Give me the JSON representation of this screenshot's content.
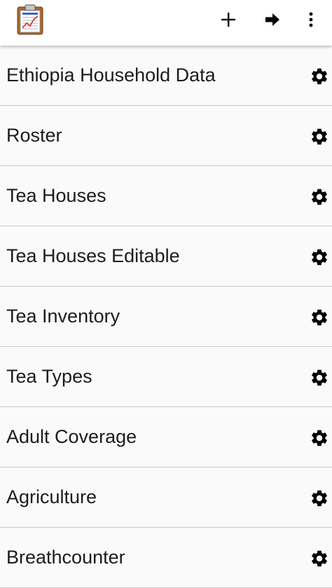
{
  "toolbar": {
    "app_icon": "clipboard-chart-icon",
    "add_icon": "plus-icon",
    "next_icon": "arrow-right-icon",
    "more_icon": "more-vert-icon"
  },
  "list": {
    "items": [
      {
        "label": "Ethiopia Household Data"
      },
      {
        "label": "Roster"
      },
      {
        "label": "Tea Houses"
      },
      {
        "label": "Tea Houses Editable"
      },
      {
        "label": "Tea Inventory"
      },
      {
        "label": "Tea Types"
      },
      {
        "label": "Adult Coverage"
      },
      {
        "label": "Agriculture"
      },
      {
        "label": "Breathcounter"
      }
    ],
    "item_icon": "gear-icon"
  },
  "colors": {
    "toolbar_bg": "#ffffff",
    "list_bg": "#fafafa",
    "divider": "#c9c9c9",
    "text": "#1c1c1c",
    "icon": "#000000"
  }
}
